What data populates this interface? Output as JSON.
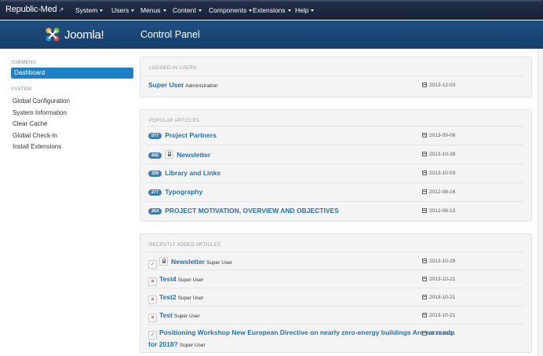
{
  "topnav": {
    "site_name": "Republic-Med",
    "site_icon": "external-link-icon",
    "menus": [
      {
        "label": "System"
      },
      {
        "label": "Users"
      },
      {
        "label": "Menus"
      },
      {
        "label": "Content"
      },
      {
        "label": "Components"
      },
      {
        "label": "Extensions"
      },
      {
        "label": "Help"
      }
    ]
  },
  "header": {
    "logo_text": "Joomla!",
    "title": "Control Panel"
  },
  "sidebar": {
    "submenu_heading": "SUBMENU",
    "active_item": "Dashboard",
    "system_heading": "SYSTEM",
    "items": [
      {
        "label": "Global Configuration"
      },
      {
        "label": "System Information"
      },
      {
        "label": "Clear Cache"
      },
      {
        "label": "Global Check-in"
      },
      {
        "label": "Install Extensions"
      }
    ]
  },
  "logged_in": {
    "heading": "LOGGED-IN USERS",
    "rows": [
      {
        "name": "Super User",
        "location": "Administration",
        "date": "2013-12-03"
      }
    ]
  },
  "popular": {
    "heading": "POPULAR ARTICLES",
    "rows": [
      {
        "hits": "577",
        "title": "Project Partners",
        "date": "2013-09-06"
      },
      {
        "hits": "442",
        "title": "Newsletter",
        "date": "2013-10-29"
      },
      {
        "hits": "339",
        "title": "Library and Links",
        "date": "2013-10-03"
      },
      {
        "hits": "277",
        "title": "Typography",
        "date": "2012-08-16"
      },
      {
        "hits": "264",
        "title": "PROJECT MOTIVATION, OVERVIEW AND OBJECTIVES",
        "date": "2012-08-13"
      }
    ]
  },
  "recent": {
    "heading": "RECENTLY ADDED ARTICLES",
    "rows": [
      {
        "title": "Newsletter",
        "author": "Super User",
        "date": "2013-10-29",
        "status": "published"
      },
      {
        "title": "Test4",
        "author": "Super User",
        "date": "2013-10-21",
        "status": "unpublished"
      },
      {
        "title": "Test2",
        "author": "Super User",
        "date": "2013-10-21",
        "status": "unpublished"
      },
      {
        "title": "Test",
        "author": "Super User",
        "date": "2013-10-21",
        "status": "unpublished"
      },
      {
        "title_line1": "Positioning Workshop New European Directive on nearly zero-energy buildings Are we ready",
        "title_line2": "for 2018?",
        "author": "Super User",
        "date": "2013-10-21",
        "status": "published"
      }
    ]
  }
}
